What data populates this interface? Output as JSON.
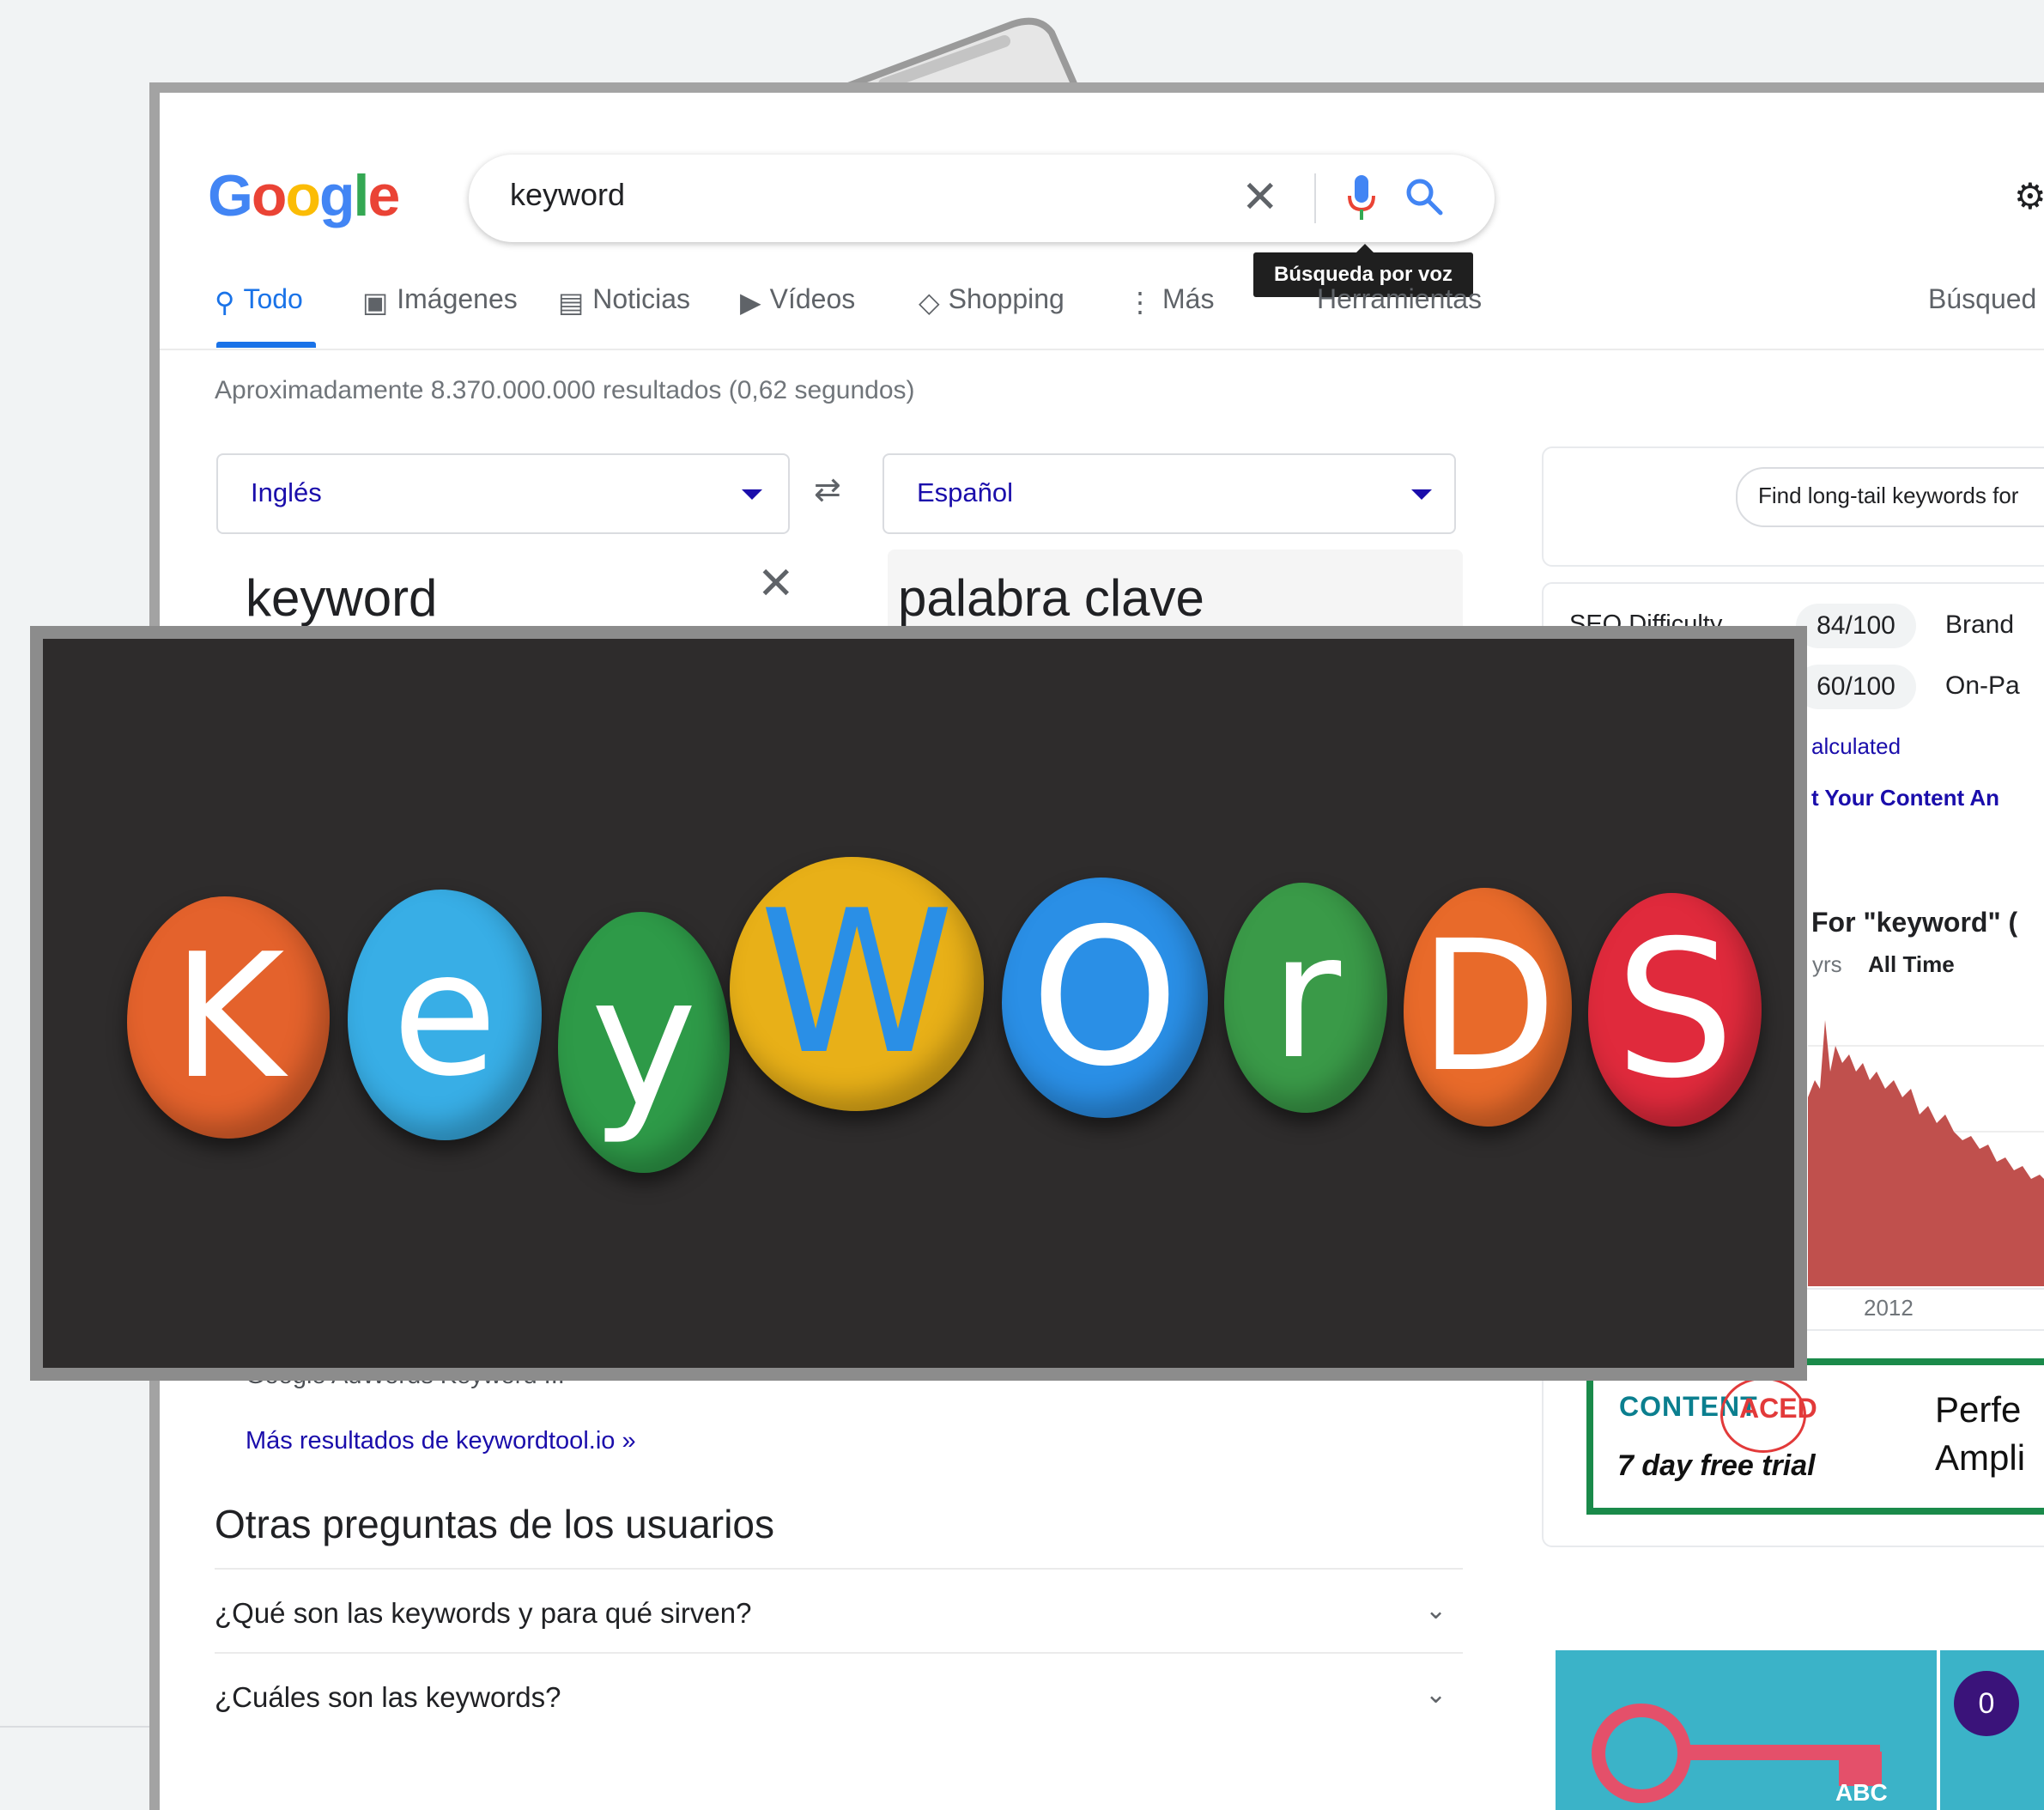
{
  "search": {
    "query": "keyword",
    "voice_tooltip": "Búsqueda por voz"
  },
  "logo": {
    "letters": [
      "G",
      "o",
      "o",
      "g",
      "l",
      "e"
    ]
  },
  "tabs": [
    {
      "label": "Todo",
      "icon": "search-icon",
      "active": true
    },
    {
      "label": "Imágenes",
      "icon": "image-icon"
    },
    {
      "label": "Noticias",
      "icon": "news-icon"
    },
    {
      "label": "Vídeos",
      "icon": "video-icon"
    },
    {
      "label": "Shopping",
      "icon": "tag-icon"
    },
    {
      "label": "Más",
      "icon": "more-vert-icon"
    },
    {
      "label": "Herramientas"
    },
    {
      "label": "Búsqued"
    }
  ],
  "result_stats": "Aproximadamente 8.370.000.000 resultados (0,62 segundos)",
  "translate": {
    "source_lang": "Inglés",
    "target_lang": "Español",
    "source_text": "keyword",
    "target_text": "palabra clave"
  },
  "side_panel": {
    "pill": "Find long-tail keywords for",
    "seo": {
      "difficulty_label": "SEO Difficulty",
      "difficulty_value": "84/100",
      "second_value": "60/100",
      "brand_label": "Brand",
      "onpage_label": "On-Pa",
      "calculated": "alculated",
      "content_link": "t Your Content An"
    },
    "trends": {
      "title": "For \"keyword\" (",
      "range": "yrs",
      "all_time": "All Time",
      "year": "2012"
    },
    "ad": {
      "brand": "CONTENT",
      "brand_ring": "ACED",
      "trial": "7 day free trial",
      "tagline_1": "Perfe",
      "tagline_2": "Ampli"
    },
    "badge_count": "0",
    "key_label": "ABC"
  },
  "results": {
    "snippet": "Google AdWords Keyword ...",
    "more_link": "Más resultados de keywordtool.io »"
  },
  "paa": {
    "title": "Otras preguntas de los usuarios",
    "questions": [
      "¿Qué son las keywords y para qué sirven?",
      "¿Cuáles son las keywords?"
    ]
  },
  "overlay_photo": {
    "letters": [
      "K",
      "e",
      "y",
      "W",
      "O",
      "r",
      "D",
      "S"
    ],
    "stone_colors": [
      "#e4622c",
      "#38aee6",
      "#2e9a48",
      "#e8b018",
      "#2a8fe6",
      "#3a9a48",
      "#e86a2a",
      "#e02a3c"
    ],
    "letter_colors": [
      "#ffffff",
      "#ffffff",
      "#ffffff",
      "#2a8fe6",
      "#ffffff",
      "#ffffff",
      "#ffffff",
      "#ffffff"
    ]
  },
  "colors": {
    "accent": "#1a73e8",
    "link": "#1a0dab",
    "chart": "#c0504d"
  }
}
